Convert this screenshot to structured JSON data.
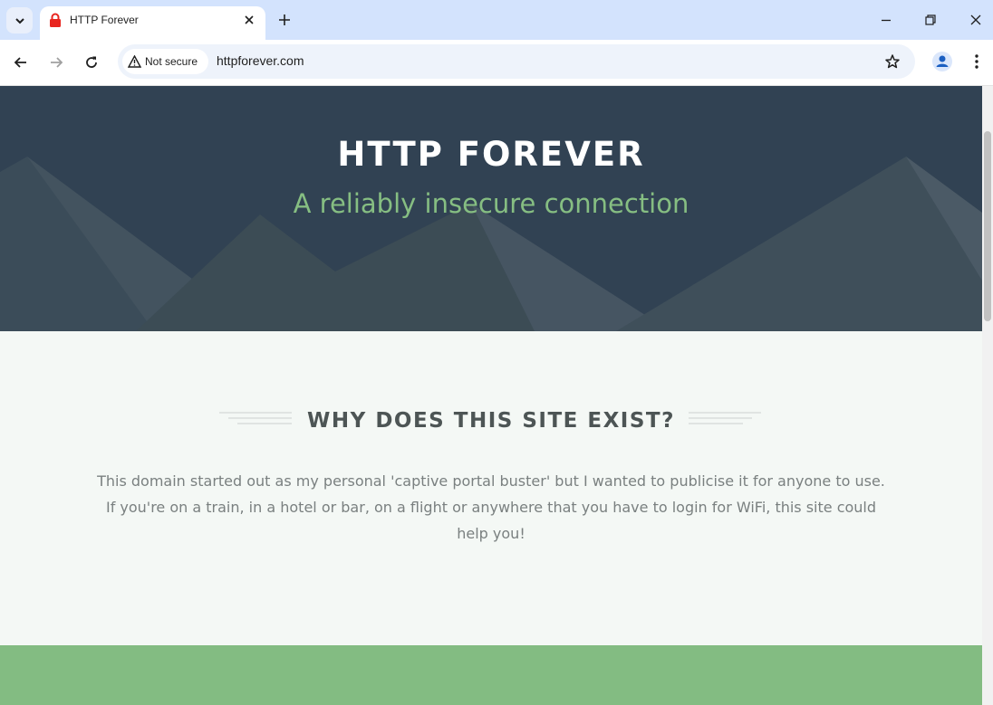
{
  "browser": {
    "tab": {
      "title": "HTTP Forever"
    },
    "omnibox": {
      "security_label": "Not secure",
      "url": "httpforever.com"
    }
  },
  "page": {
    "hero": {
      "title": "HTTP FOREVER",
      "subtitle": "A reliably insecure connection"
    },
    "why": {
      "heading": "WHY DOES THIS SITE EXIST?",
      "body": "This domain started out as my personal 'captive portal buster' but I wanted to publicise it for anyone to use. If you're on a train, in a hotel or bar, on a flight or anywhere that you have to login for WiFi, this site could help you!"
    }
  },
  "colors": {
    "hero_bg": "#314253",
    "accent_green": "#86be82",
    "band_green": "#83bc82",
    "page_bg": "#f4f8f5"
  }
}
